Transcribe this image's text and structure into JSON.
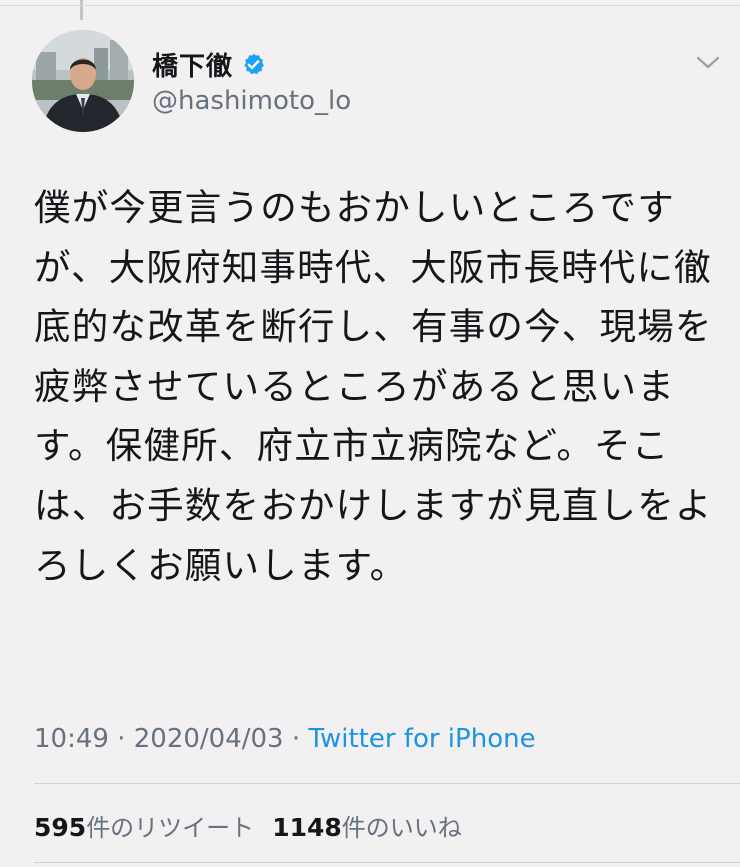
{
  "tweet": {
    "author": {
      "name": "橋下徹",
      "handle": "@hashimoto_lo",
      "verified": true
    },
    "text": "僕が今更言うのもおかしいところですが、大阪府知事時代、大阪市長時代に徹底的な改革を断行し、有事の今、現場を疲弊させているところがあると思います。保健所、府立市立病院など。そこは、お手数をおかけしますが見直しをよろしくお願いします。",
    "time": "10:49",
    "date": "2020/04/03",
    "separator": " · ",
    "source": "Twitter for iPhone",
    "retweets": {
      "count": "595",
      "label": "件のリツイート"
    },
    "likes": {
      "count": "1148",
      "label": "件のいいね"
    }
  },
  "colors": {
    "background": "#f2f0f1",
    "text": "#14171a",
    "secondary": "#66727f",
    "link": "#1b95e0",
    "verified": "#1da1f2"
  },
  "icons": [
    "verified-badge-icon",
    "chevron-down-icon"
  ]
}
